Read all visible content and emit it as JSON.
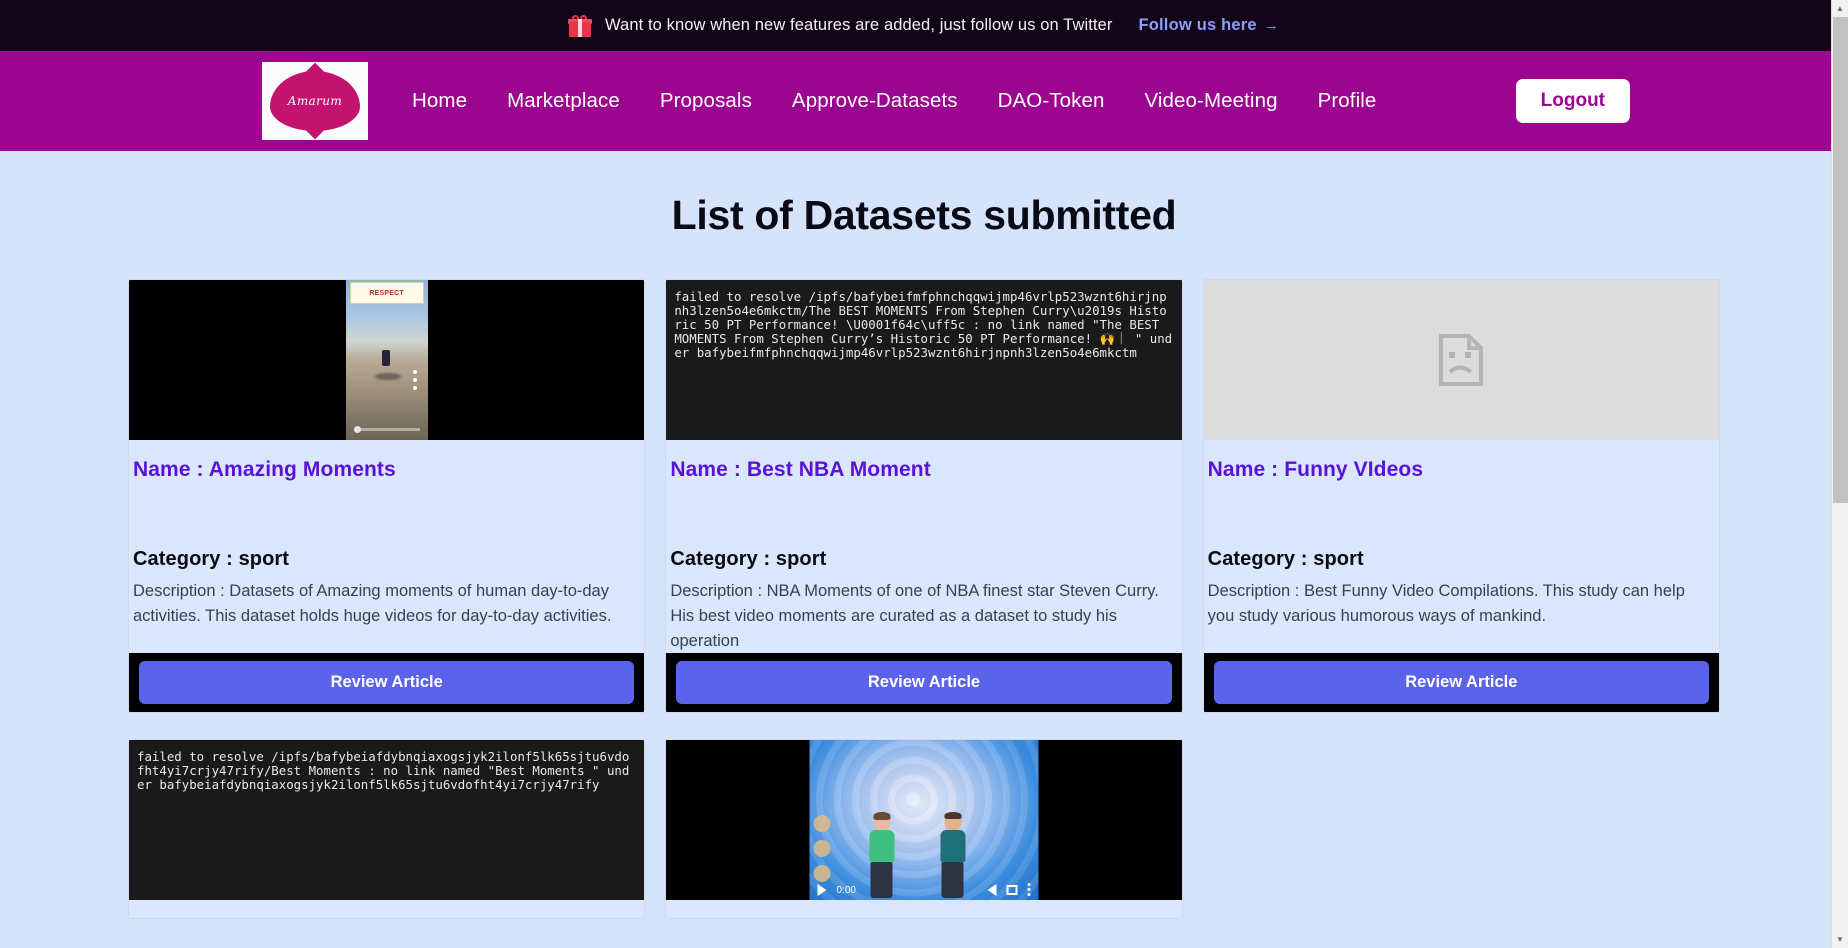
{
  "announcement": {
    "icon": "gift-icon",
    "text": "Want to know when new features are added, just follow us on Twitter",
    "link_label": "Follow us here",
    "link_arrow": "→",
    "background": "#120518",
    "link_color": "#8f9bff"
  },
  "navbar": {
    "background": "#9c0590",
    "logo_text": "Amarum",
    "links": [
      {
        "label": "Home"
      },
      {
        "label": "Marketplace"
      },
      {
        "label": "Proposals"
      },
      {
        "label": "Approve-Datasets"
      },
      {
        "label": "DAO-Token"
      },
      {
        "label": "Video-Meeting"
      },
      {
        "label": "Profile"
      }
    ],
    "logout_label": "Logout"
  },
  "page": {
    "title": "List of Datasets submitted",
    "background": "#d6e4fb",
    "accent_name_color": "#5b12d8",
    "button_color": "#5a63ea"
  },
  "cards": [
    {
      "media_kind": "video",
      "media_caption": "RESPECT",
      "name_label": "Name : Amazing Moments",
      "category_label": "Category : sport",
      "description": "Description : Datasets of Amazing moments of human day-to-day activities. This dataset holds huge videos for day-to-day activities.",
      "button_label": "Review Article"
    },
    {
      "media_kind": "error",
      "error_text": "failed to resolve /ipfs/bafybeifmfphnchqqwijmp46vrlp523wznt6hirjnpnh3lzen5o4e6mkctm/The BEST MOMENTS From Stephen Curry\\u2019s Historic 50 PT Performance! \\U0001f64c\\uff5c : no link named \"The BEST MOMENTS From Stephen Curry’s Historic 50 PT Performance! 🙌｜ \" under bafybeifmfphnchqqwijmp46vrlp523wznt6hirjnpnh3lzen5o4e6mkctm",
      "name_label": "Name : Best NBA Moment",
      "category_label": "Category : sport",
      "description": "Description : NBA Moments of one of NBA finest star Steven Curry. His best video moments are curated as a dataset to study his operation",
      "button_label": "Review Article"
    },
    {
      "media_kind": "broken-image",
      "name_label": "Name : Funny VIdeos",
      "category_label": "Category : sport",
      "description": "Description : Best Funny Video Compilations. This study can help you study various humorous ways of mankind.",
      "button_label": "Review Article"
    },
    {
      "media_kind": "error",
      "error_text": "failed to resolve /ipfs/bafybeiafdybnqiaxogsjyk2ilonf5lk65sjtu6vdofht4yi7crjy47rify/Best Moments : no link named \"Best Moments \" under bafybeiafdybnqiaxogsjyk2ilonf5lk65sjtu6vdofht4yi7crjy47rify"
    },
    {
      "media_kind": "video2",
      "time_label": "0:00"
    },
    {
      "media_kind": "blank"
    }
  ],
  "scrollbar": {
    "up_arrow": "▲",
    "down_arrow": "▼"
  }
}
